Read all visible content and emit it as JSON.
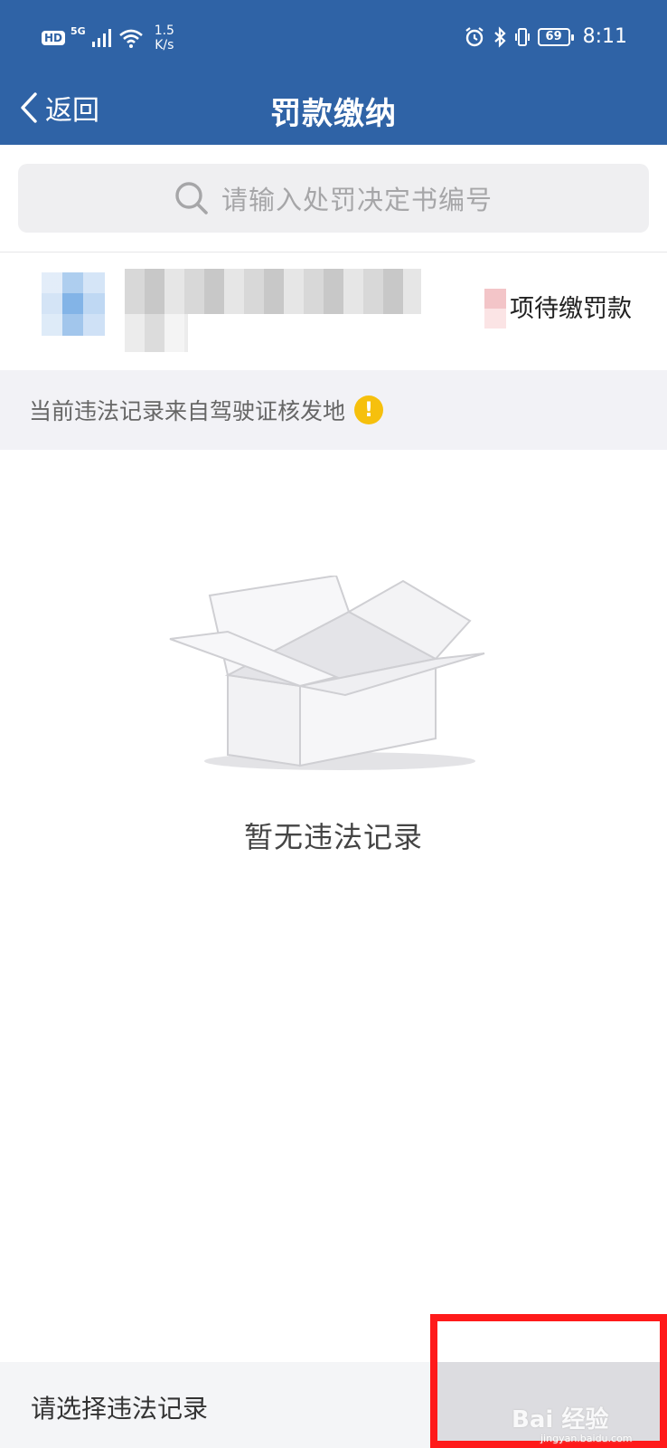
{
  "status_bar": {
    "hd": "HD",
    "network": "5G",
    "speed_value": "1.5",
    "speed_unit": "K/s",
    "battery": "69",
    "time": "8:11",
    "icons": [
      "signal-icon",
      "wifi-icon",
      "alarm-icon",
      "bluetooth-icon",
      "vibrate-icon",
      "battery-icon"
    ]
  },
  "nav": {
    "back_label": "返回",
    "title": "罚款缴纳"
  },
  "search": {
    "placeholder": "请输入处罚决定书编号"
  },
  "license": {
    "pending_text": "项待缴罚款"
  },
  "notice": {
    "text": "当前违法记录来自驾驶证核发地",
    "badge": "!"
  },
  "empty": {
    "message": "暂无违法记录"
  },
  "footer": {
    "label": "请选择违法记录"
  },
  "watermark": {
    "text": "Bai 经验",
    "sub": "jingyan.baidu.com"
  },
  "colors": {
    "header": "#2f63a6",
    "highlight": "#ff1a1a",
    "notice_badge": "#f6c00d"
  }
}
